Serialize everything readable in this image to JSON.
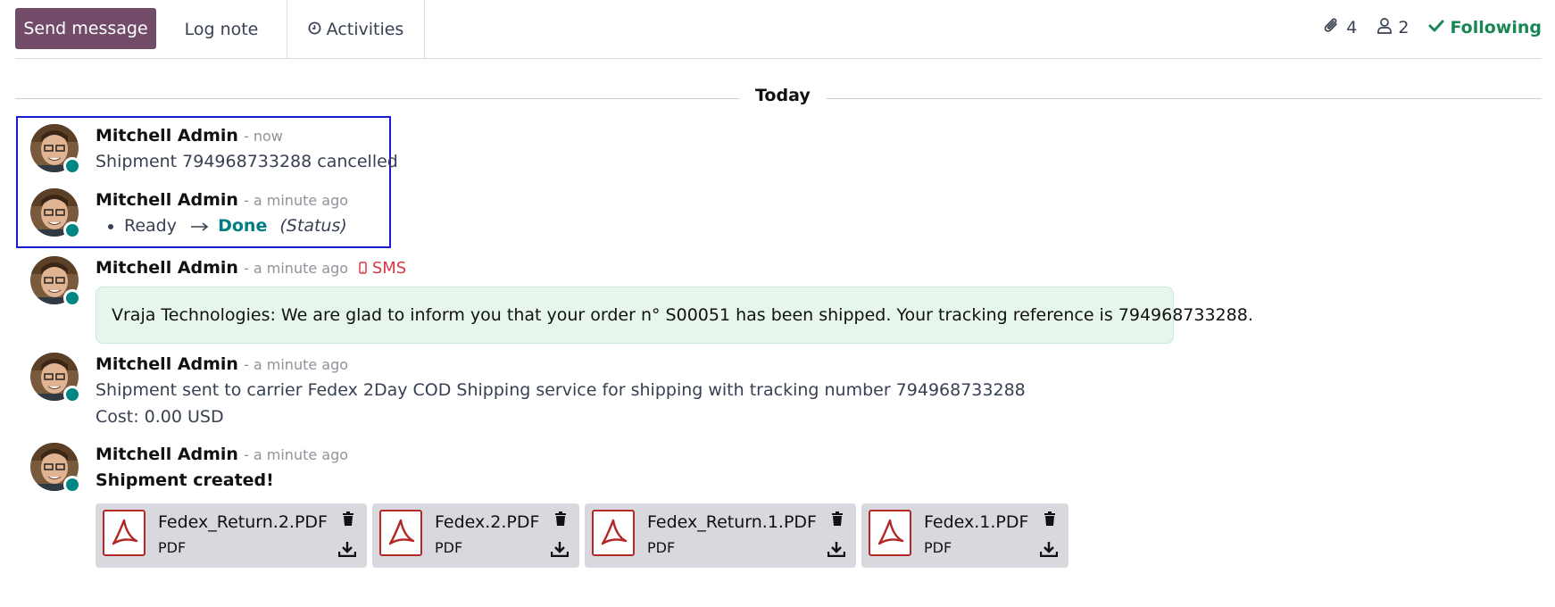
{
  "toolbar": {
    "send_label": "Send message",
    "log_label": "Log note",
    "activities_label": "Activities",
    "attachments_count": "4",
    "followers_count": "2",
    "following_label": "Following"
  },
  "divider": {
    "label": "Today"
  },
  "messages": [
    {
      "author": "Mitchell Admin",
      "time": "- now",
      "body": "Shipment 794968733288 cancelled"
    },
    {
      "author": "Mitchell Admin",
      "time": "- a minute ago",
      "old_value": "Ready",
      "new_value": "Done",
      "field": "(Status)"
    },
    {
      "author": "Mitchell Admin",
      "time": "- a minute ago",
      "tag": "SMS",
      "body": "Vraja Technologies: We are glad to inform you that your order n° S00051 has been shipped. Your tracking reference is 794968733288."
    },
    {
      "author": "Mitchell Admin",
      "time": "- a minute ago",
      "line1": "Shipment sent to carrier Fedex 2Day COD Shipping service for shipping with tracking number 794968733288",
      "line2": "Cost: 0.00 USD"
    },
    {
      "author": "Mitchell Admin",
      "time": "- a minute ago",
      "body": "Shipment created!"
    }
  ],
  "attachments": [
    {
      "name": "Fedex_Return.2.PDF",
      "type": "PDF"
    },
    {
      "name": "Fedex.2.PDF",
      "type": "PDF"
    },
    {
      "name": "Fedex_Return.1.PDF",
      "type": "PDF"
    },
    {
      "name": "Fedex.1.PDF",
      "type": "PDF"
    }
  ],
  "colors": {
    "primary": "#714B67",
    "following": "#198754",
    "online": "#008784",
    "sms": "#dc3545",
    "highlight_border": "#1a1ad6"
  }
}
